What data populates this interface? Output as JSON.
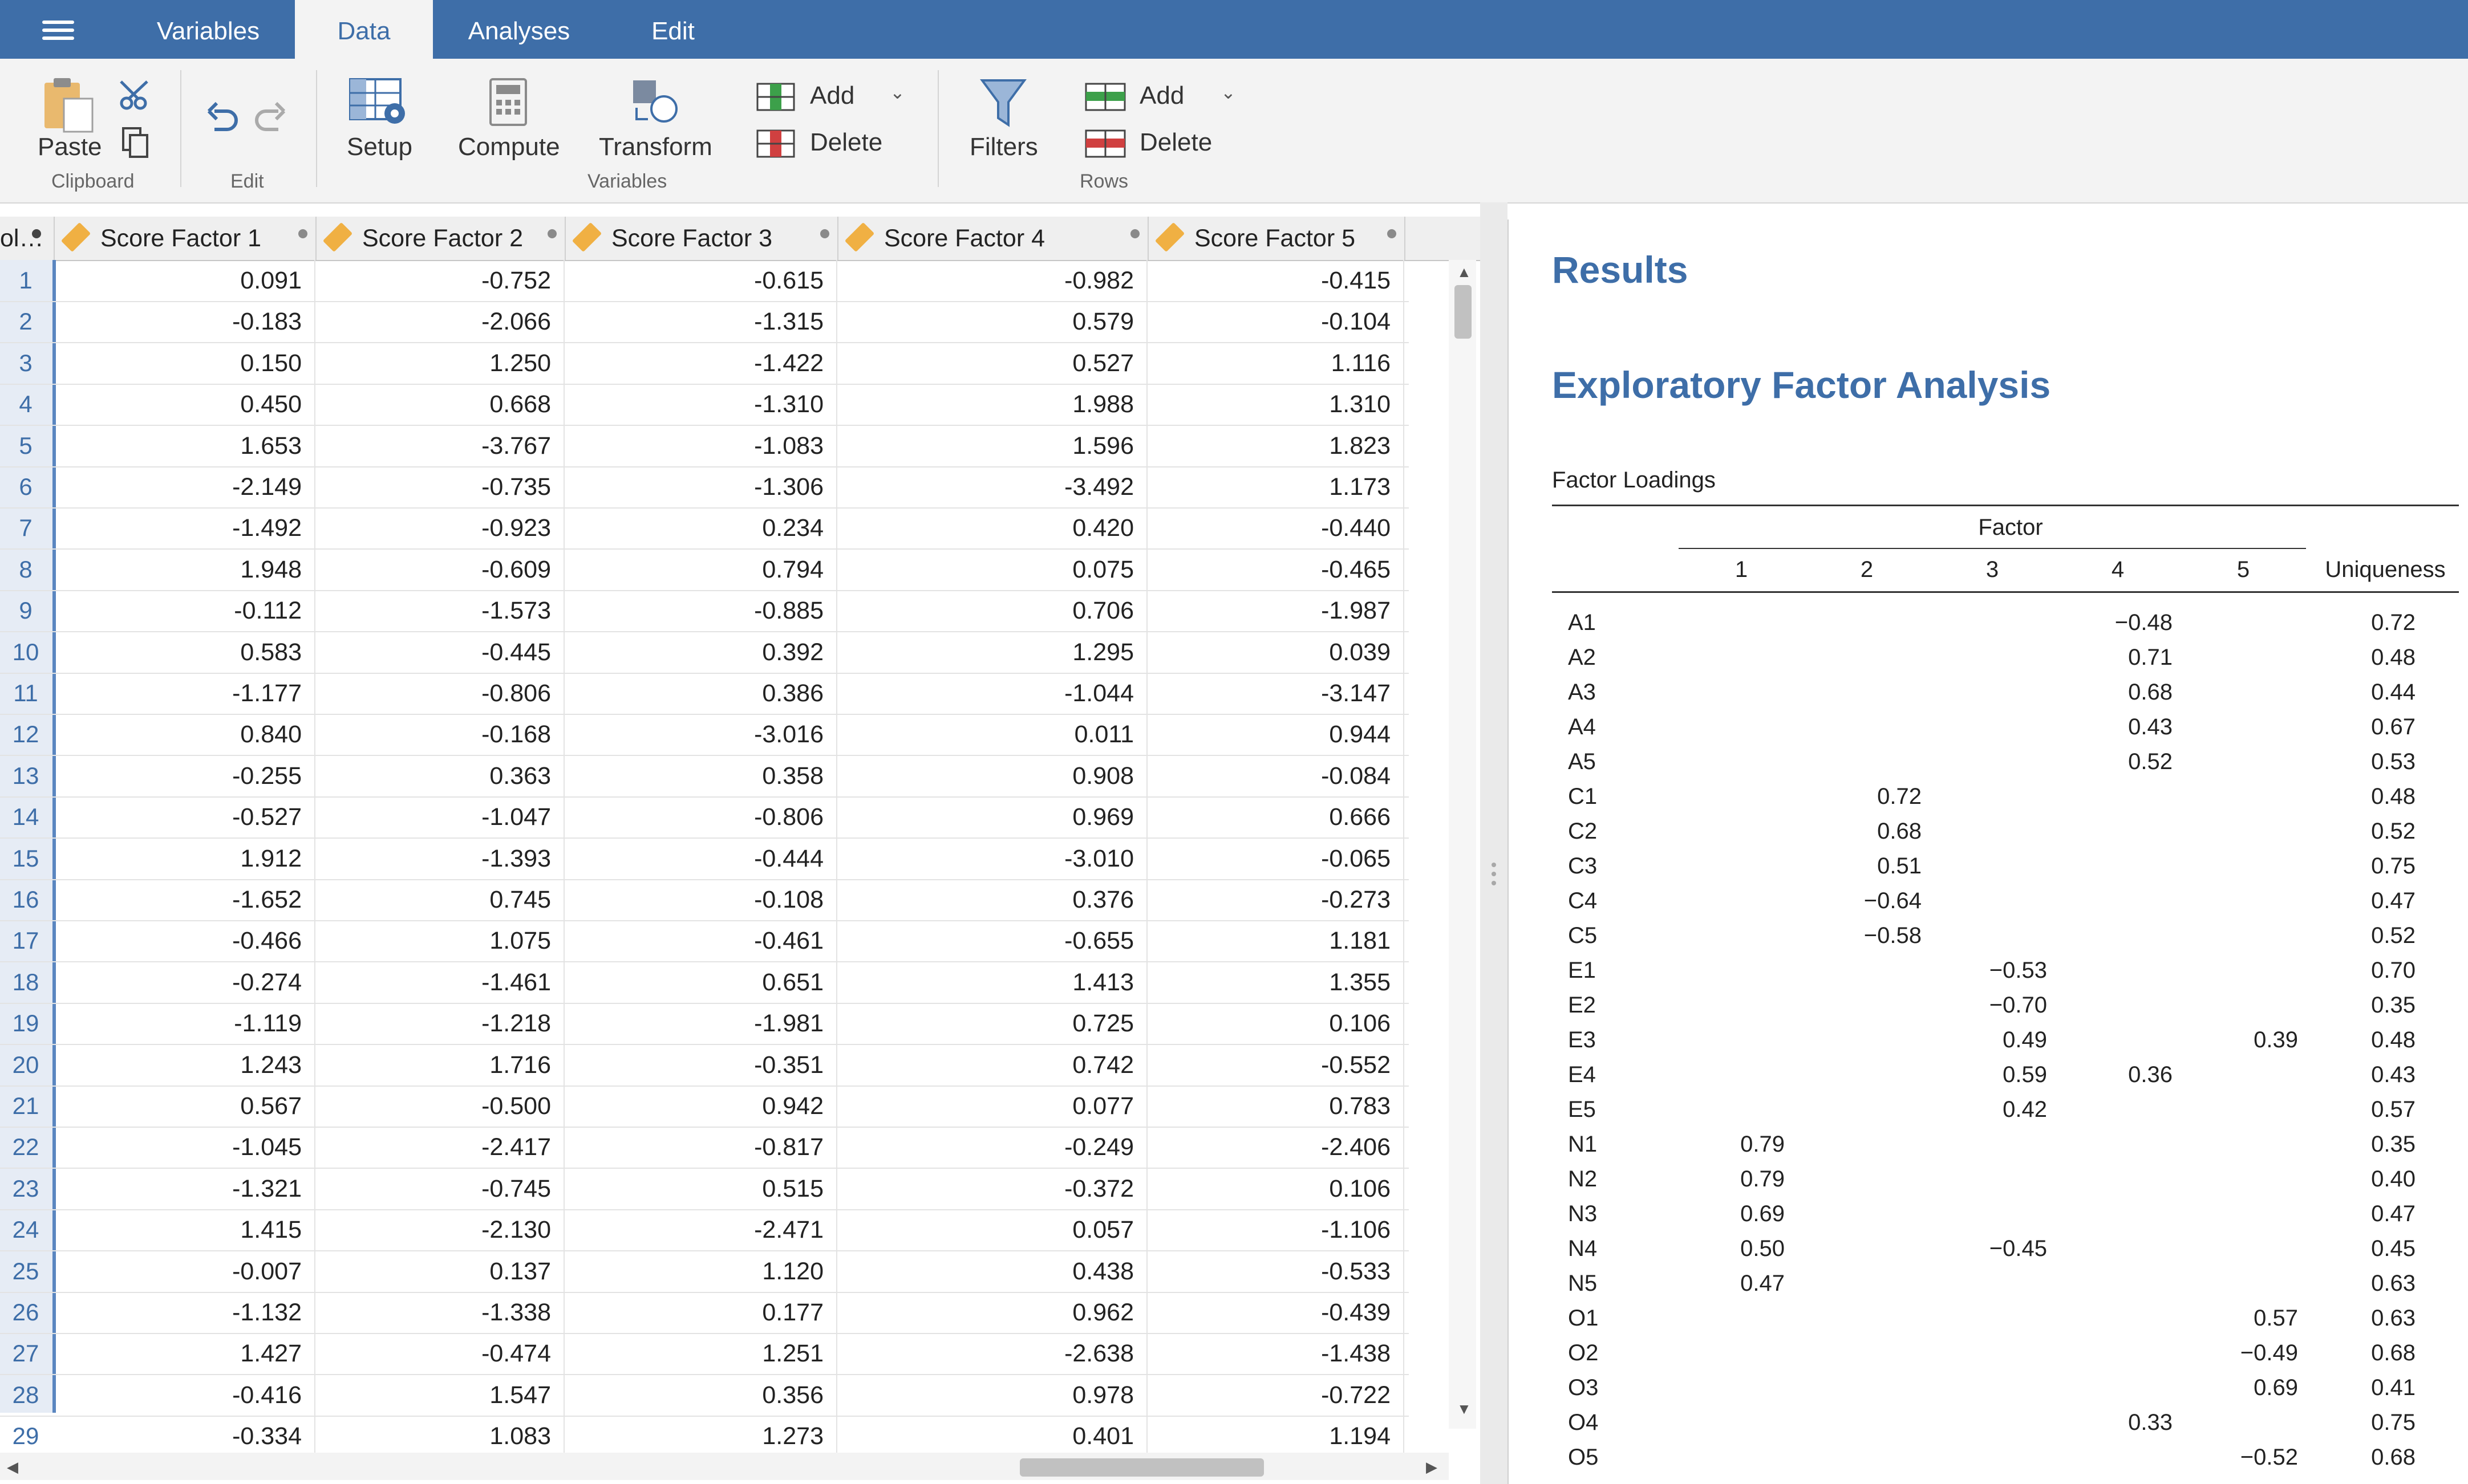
{
  "tabs": [
    "Variables",
    "Data",
    "Analyses",
    "Edit"
  ],
  "active_tab": "Data",
  "ribbon": {
    "paste": "Paste",
    "clipboard_group": "Clipboard",
    "edit_group": "Edit",
    "setup": "Setup",
    "compute": "Compute",
    "transform": "Transform",
    "variables_group": "Variables",
    "var_add": "Add",
    "var_delete": "Delete",
    "filters": "Filters",
    "row_add": "Add",
    "row_delete": "Delete",
    "rows_group": "Rows"
  },
  "sheet": {
    "first_col_truncated": "ol…",
    "columns": [
      "Score Factor 1",
      "Score Factor 2",
      "Score Factor 3",
      "Score Factor 4",
      "Score Factor 5"
    ],
    "rows": [
      [
        "0.091",
        "-0.752",
        "-0.615",
        "-0.982",
        "-0.415"
      ],
      [
        "-0.183",
        "-2.066",
        "-1.315",
        "0.579",
        "-0.104"
      ],
      [
        "0.150",
        "1.250",
        "-1.422",
        "0.527",
        "1.116"
      ],
      [
        "0.450",
        "0.668",
        "-1.310",
        "1.988",
        "1.310"
      ],
      [
        "1.653",
        "-3.767",
        "-1.083",
        "1.596",
        "1.823"
      ],
      [
        "-2.149",
        "-0.735",
        "-1.306",
        "-3.492",
        "1.173"
      ],
      [
        "-1.492",
        "-0.923",
        "0.234",
        "0.420",
        "-0.440"
      ],
      [
        "1.948",
        "-0.609",
        "0.794",
        "0.075",
        "-0.465"
      ],
      [
        "-0.112",
        "-1.573",
        "-0.885",
        "0.706",
        "-1.987"
      ],
      [
        "0.583",
        "-0.445",
        "0.392",
        "1.295",
        "0.039"
      ],
      [
        "-1.177",
        "-0.806",
        "0.386",
        "-1.044",
        "-3.147"
      ],
      [
        "0.840",
        "-0.168",
        "-3.016",
        "0.011",
        "0.944"
      ],
      [
        "-0.255",
        "0.363",
        "0.358",
        "0.908",
        "-0.084"
      ],
      [
        "-0.527",
        "-1.047",
        "-0.806",
        "0.969",
        "0.666"
      ],
      [
        "1.912",
        "-1.393",
        "-0.444",
        "-3.010",
        "-0.065"
      ],
      [
        "-1.652",
        "0.745",
        "-0.108",
        "0.376",
        "-0.273"
      ],
      [
        "-0.466",
        "1.075",
        "-0.461",
        "-0.655",
        "1.181"
      ],
      [
        "-0.274",
        "-1.461",
        "0.651",
        "1.413",
        "1.355"
      ],
      [
        "-1.119",
        "-1.218",
        "-1.981",
        "0.725",
        "0.106"
      ],
      [
        "1.243",
        "1.716",
        "-0.351",
        "0.742",
        "-0.552"
      ],
      [
        "0.567",
        "-0.500",
        "0.942",
        "0.077",
        "0.783"
      ],
      [
        "-1.045",
        "-2.417",
        "-0.817",
        "-0.249",
        "-2.406"
      ],
      [
        "-1.321",
        "-0.745",
        "0.515",
        "-0.372",
        "0.106"
      ],
      [
        "1.415",
        "-2.130",
        "-2.471",
        "0.057",
        "-1.106"
      ],
      [
        "-0.007",
        "0.137",
        "1.120",
        "0.438",
        "-0.533"
      ],
      [
        "-1.132",
        "-1.338",
        "0.177",
        "0.962",
        "-0.439"
      ],
      [
        "1.427",
        "-0.474",
        "1.251",
        "-2.638",
        "-1.438"
      ],
      [
        "-0.416",
        "1.547",
        "0.356",
        "0.978",
        "-0.722"
      ],
      [
        "-0.334",
        "1.083",
        "1.273",
        "0.401",
        "1.194"
      ]
    ]
  },
  "results": {
    "title": "Results",
    "analysis_title": "Exploratory Factor Analysis",
    "table_title": "Factor Loadings",
    "factor_header": "Factor",
    "factor_numbers": [
      "1",
      "2",
      "3",
      "4",
      "5"
    ],
    "uniqueness_header": "Uniqueness",
    "rows": [
      {
        "item": "A1",
        "loadings": [
          "",
          "",
          "",
          "−0.48",
          ""
        ],
        "uniqueness": "0.72"
      },
      {
        "item": "A2",
        "loadings": [
          "",
          "",
          "",
          "0.71",
          ""
        ],
        "uniqueness": "0.48"
      },
      {
        "item": "A3",
        "loadings": [
          "",
          "",
          "",
          "0.68",
          ""
        ],
        "uniqueness": "0.44"
      },
      {
        "item": "A4",
        "loadings": [
          "",
          "",
          "",
          "0.43",
          ""
        ],
        "uniqueness": "0.67"
      },
      {
        "item": "A5",
        "loadings": [
          "",
          "",
          "",
          "0.52",
          ""
        ],
        "uniqueness": "0.53"
      },
      {
        "item": "C1",
        "loadings": [
          "",
          "0.72",
          "",
          "",
          ""
        ],
        "uniqueness": "0.48"
      },
      {
        "item": "C2",
        "loadings": [
          "",
          "0.68",
          "",
          "",
          ""
        ],
        "uniqueness": "0.52"
      },
      {
        "item": "C3",
        "loadings": [
          "",
          "0.51",
          "",
          "",
          ""
        ],
        "uniqueness": "0.75"
      },
      {
        "item": "C4",
        "loadings": [
          "",
          "−0.64",
          "",
          "",
          ""
        ],
        "uniqueness": "0.47"
      },
      {
        "item": "C5",
        "loadings": [
          "",
          "−0.58",
          "",
          "",
          ""
        ],
        "uniqueness": "0.52"
      },
      {
        "item": "E1",
        "loadings": [
          "",
          "",
          "−0.53",
          "",
          ""
        ],
        "uniqueness": "0.70"
      },
      {
        "item": "E2",
        "loadings": [
          "",
          "",
          "−0.70",
          "",
          ""
        ],
        "uniqueness": "0.35"
      },
      {
        "item": "E3",
        "loadings": [
          "",
          "",
          "0.49",
          "",
          "0.39"
        ],
        "uniqueness": "0.48"
      },
      {
        "item": "E4",
        "loadings": [
          "",
          "",
          "0.59",
          "0.36",
          ""
        ],
        "uniqueness": "0.43"
      },
      {
        "item": "E5",
        "loadings": [
          "",
          "",
          "0.42",
          "",
          ""
        ],
        "uniqueness": "0.57"
      },
      {
        "item": "N1",
        "loadings": [
          "0.79",
          "",
          "",
          "",
          ""
        ],
        "uniqueness": "0.35"
      },
      {
        "item": "N2",
        "loadings": [
          "0.79",
          "",
          "",
          "",
          ""
        ],
        "uniqueness": "0.40"
      },
      {
        "item": "N3",
        "loadings": [
          "0.69",
          "",
          "",
          "",
          ""
        ],
        "uniqueness": "0.47"
      },
      {
        "item": "N4",
        "loadings": [
          "0.50",
          "",
          "−0.45",
          "",
          ""
        ],
        "uniqueness": "0.45"
      },
      {
        "item": "N5",
        "loadings": [
          "0.47",
          "",
          "",
          "",
          ""
        ],
        "uniqueness": "0.63"
      },
      {
        "item": "O1",
        "loadings": [
          "",
          "",
          "",
          "",
          "0.57"
        ],
        "uniqueness": "0.63"
      },
      {
        "item": "O2",
        "loadings": [
          "",
          "",
          "",
          "",
          "−0.49"
        ],
        "uniqueness": "0.68"
      },
      {
        "item": "O3",
        "loadings": [
          "",
          "",
          "",
          "",
          "0.69"
        ],
        "uniqueness": "0.41"
      },
      {
        "item": "O4",
        "loadings": [
          "",
          "",
          "",
          "0.33",
          ""
        ],
        "uniqueness": "0.75"
      },
      {
        "item": "O5",
        "loadings": [
          "",
          "",
          "",
          "",
          "−0.52"
        ],
        "uniqueness": "0.68"
      }
    ]
  },
  "colors": {
    "brand_blue": "#3e6ea8",
    "ribbon_bg": "#f3f3f3",
    "measure_icon": "#f0b043"
  }
}
